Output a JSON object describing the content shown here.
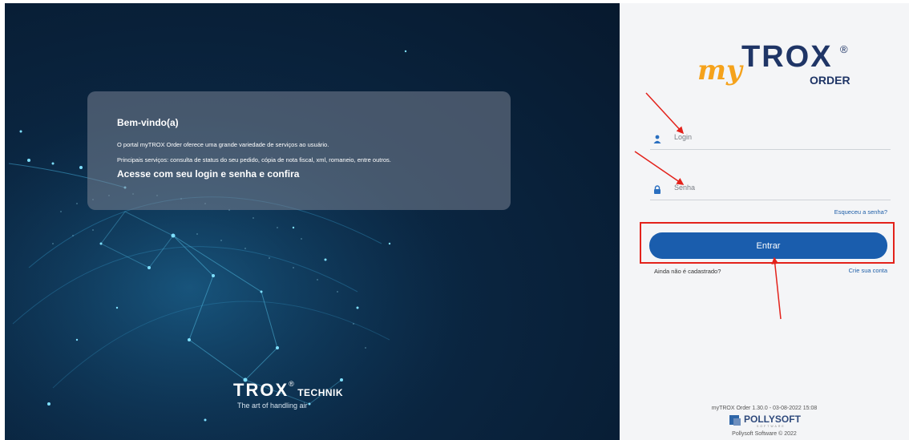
{
  "hero": {
    "welcome_title": "Bem-vindo(a)",
    "welcome_line1": "O portal myTROX Order oferece uma grande variedade de serviços ao usuário.",
    "welcome_line2": "Principais serviços: consulta de status do seu pedido, cópia de nota fiscal, xml, romaneio, entre outros.",
    "welcome_cta": "Acesse com seu login e senha e confira",
    "brand_logo": "TROX",
    "brand_reg": "®",
    "brand_suffix": "TECHNIK",
    "brand_tagline": "The art of handling air"
  },
  "panel": {
    "logo_my": "my",
    "logo_trox": "TROX",
    "logo_reg": "®",
    "logo_order": "ORDER",
    "login_placeholder": "Login",
    "password_placeholder": "Senha",
    "forgot_password": "Esqueceu a senha?",
    "submit_label": "Entrar",
    "register_prompt": "Ainda não é cadastrado?",
    "create_account": "Crie sua conta",
    "version": "myTROX Order 1.30.0 - 03-08-2022 15:08",
    "pollysoft_name": "POLLYSOFT",
    "pollysoft_sub": "SOFTWARE",
    "copyright": "Pollysoft Software © 2022"
  },
  "colors": {
    "accent": "#1a5dad",
    "logo_orange": "#f5a21b",
    "logo_navy": "#1f3566",
    "annotation_red": "#e3221b",
    "hero_bg": "#0a2540"
  },
  "icons": {
    "login": "user-icon",
    "password": "lock-icon"
  }
}
